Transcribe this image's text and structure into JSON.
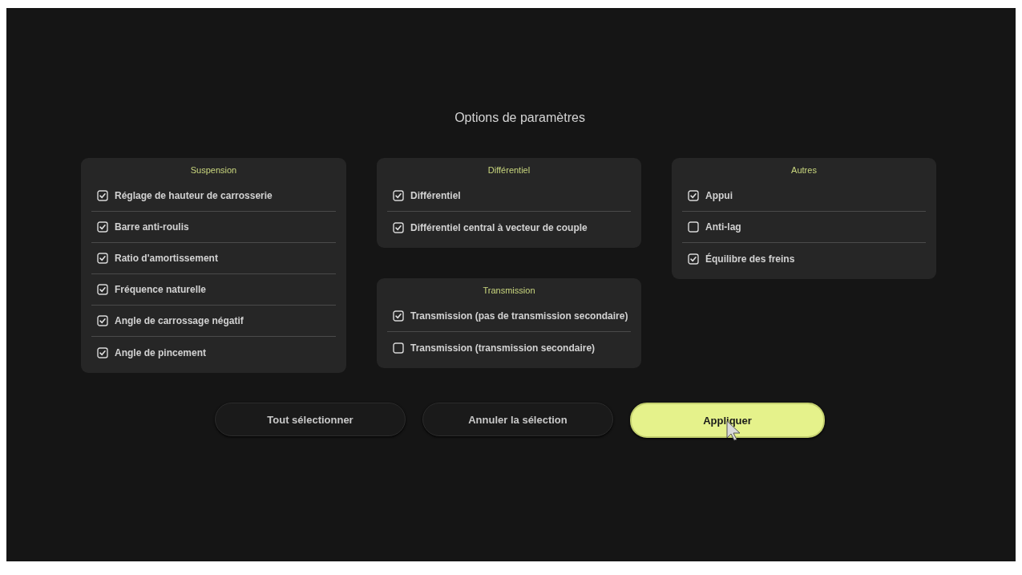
{
  "dialog": {
    "title": "Options de paramètres"
  },
  "columns": [
    [
      {
        "title": "Suspension",
        "options": [
          {
            "label": "Réglage de hauteur de carrosserie",
            "checked": true
          },
          {
            "label": "Barre anti-roulis",
            "checked": true
          },
          {
            "label": "Ratio d'amortissement",
            "checked": true
          },
          {
            "label": "Fréquence naturelle",
            "checked": true
          },
          {
            "label": "Angle de carrossage négatif",
            "checked": true
          },
          {
            "label": "Angle de pincement",
            "checked": true
          }
        ]
      }
    ],
    [
      {
        "title": "Différentiel",
        "options": [
          {
            "label": "Différentiel",
            "checked": true
          },
          {
            "label": "Différentiel central à vecteur de couple",
            "checked": true
          }
        ]
      },
      {
        "title": "Transmission",
        "options": [
          {
            "label": "Transmission (pas de transmission secondaire)",
            "checked": true
          },
          {
            "label": "Transmission (transmission secondaire)",
            "checked": false
          }
        ]
      }
    ],
    [
      {
        "title": "Autres",
        "options": [
          {
            "label": "Appui",
            "checked": true
          },
          {
            "label": "Anti-lag",
            "checked": false
          },
          {
            "label": "Équilibre des freins",
            "checked": true
          }
        ]
      }
    ]
  ],
  "buttons": [
    {
      "label": "Tout sélectionner",
      "kind": "secondary"
    },
    {
      "label": "Annuler la sélection",
      "kind": "secondary"
    },
    {
      "label": "Appliquer",
      "kind": "primary"
    }
  ]
}
